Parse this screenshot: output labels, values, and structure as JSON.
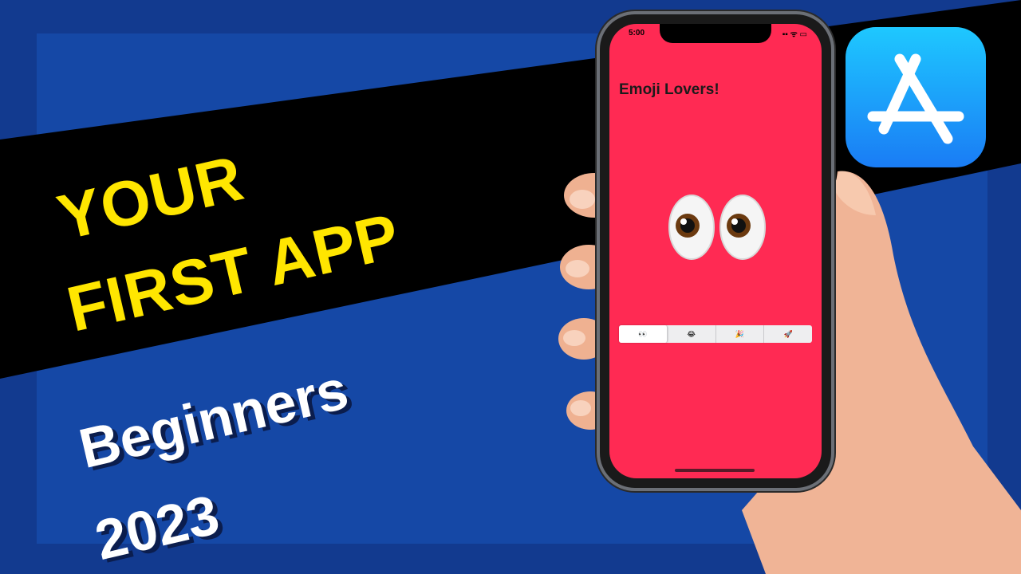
{
  "thumbnail": {
    "headline_line1": "YOUR",
    "headline_line2": "FIRST APP",
    "subtitle_line1": "Beginners",
    "subtitle_line2": "2023"
  },
  "phone": {
    "status_time": "5:00",
    "status_icons": "▪▪ ᯤ ▭",
    "app_title": "Emoji Lovers!",
    "display_emoji": "eyes",
    "segments": [
      {
        "label": "👀",
        "selected": true
      },
      {
        "label": "😂",
        "selected": false
      },
      {
        "label": "🎉",
        "selected": false
      },
      {
        "label": "🚀",
        "selected": false
      }
    ]
  },
  "icons": {
    "app_store": "app-store-icon"
  },
  "colors": {
    "background_dark_blue": "#123a8f",
    "panel_blue": "#1548a6",
    "band_black": "#000000",
    "headline_yellow": "#ffe600",
    "screen_red": "#ff2a53",
    "appstore_top": "#1ec8ff",
    "appstore_bottom": "#1a7cf5"
  }
}
